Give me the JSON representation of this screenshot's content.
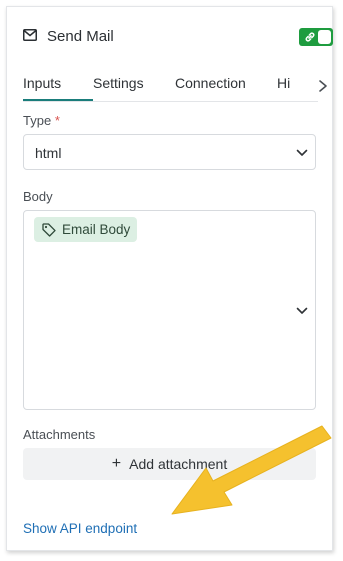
{
  "header": {
    "title": "Send Mail",
    "icon": "mail-icon",
    "toggle": {
      "state": "on",
      "color": "#1e9c3f",
      "icon": "link-icon"
    }
  },
  "tabs": [
    {
      "label": "Inputs",
      "active": true
    },
    {
      "label": "Settings",
      "active": false
    },
    {
      "label": "Connection",
      "active": false
    },
    {
      "label": "Hi",
      "active": false
    }
  ],
  "form": {
    "type": {
      "label": "Type",
      "required_marker": "*",
      "value": "html"
    },
    "body": {
      "label": "Body",
      "chip_label": "Email Body",
      "chip_icon": "tag-icon"
    },
    "attachments": {
      "label": "Attachments",
      "button_label": "Add attachment"
    }
  },
  "footer": {
    "api_link": "Show API endpoint"
  },
  "colors": {
    "accent": "#1a7d7b",
    "link": "#1f6fb5",
    "annotation_arrow": "#f5c12e"
  }
}
